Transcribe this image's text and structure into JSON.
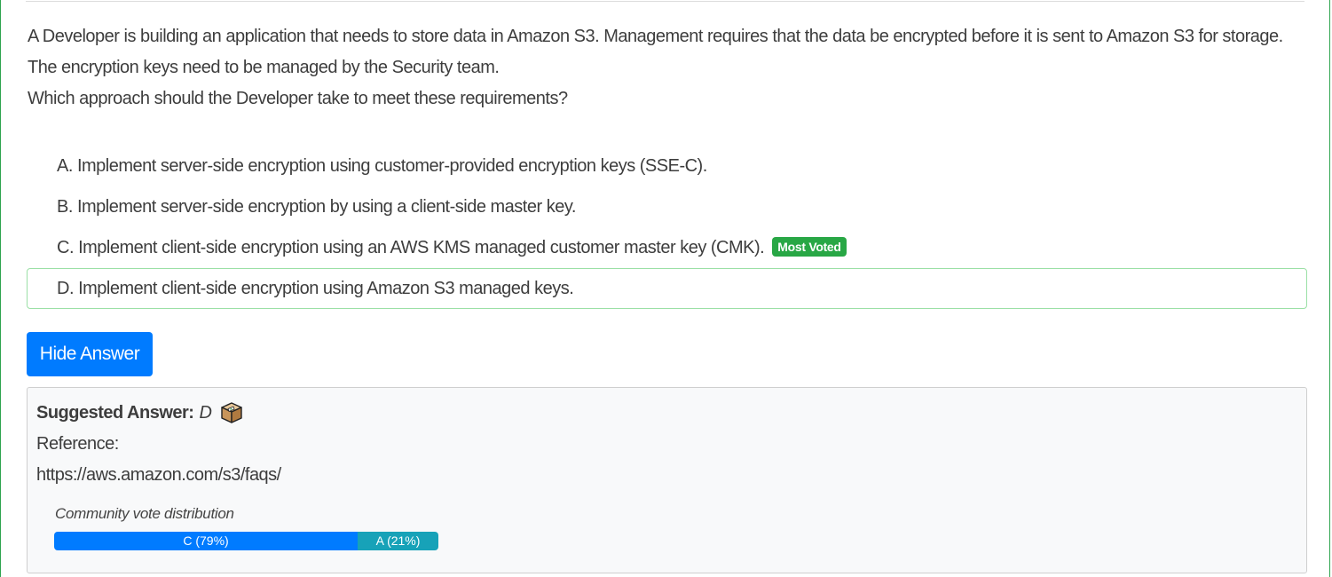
{
  "question": {
    "line1": "A Developer is building an application that needs to store data in Amazon S3. Management requires that the data be encrypted before it is sent to Amazon S3 for storage.",
    "line2": "The encryption keys need to be managed by the Security team.",
    "line3": "Which approach should the Developer take to meet these requirements?"
  },
  "choices": [
    {
      "letter": "A.",
      "text": "Implement server-side encryption using customer-provided encryption keys (SSE-C)."
    },
    {
      "letter": "B.",
      "text": "Implement server-side encryption by using a client-side master key."
    },
    {
      "letter": "C.",
      "text": "Implement client-side encryption using an AWS KMS managed customer master key (CMK).",
      "badge": "Most Voted"
    },
    {
      "letter": "D.",
      "text": "Implement client-side encryption using Amazon S3 managed keys."
    }
  ],
  "hide_answer_label": "Hide Answer",
  "answer": {
    "suggested_label": "Suggested Answer:",
    "suggested_value": "D",
    "box_icon": "package-box-icon",
    "reference_label": "Reference:",
    "reference_url": "https://aws.amazon.com/s3/faqs/"
  },
  "votes": {
    "title": "Community vote distribution",
    "segments": [
      {
        "label": "C (79%)",
        "percent": 79,
        "color": "#007bff"
      },
      {
        "label": "A (21%)",
        "percent": 21,
        "color": "#17a2b8"
      }
    ]
  }
}
